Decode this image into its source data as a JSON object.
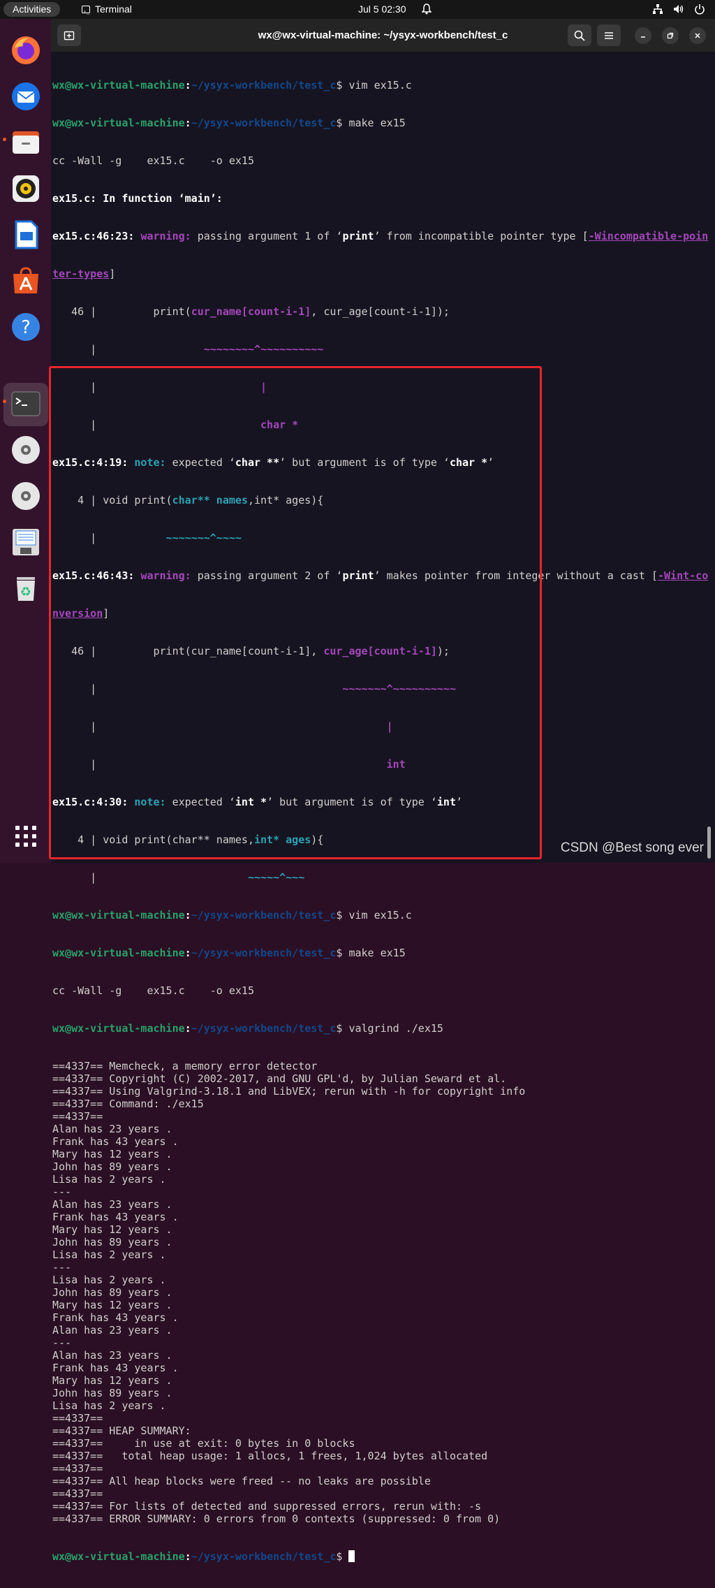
{
  "topbar": {
    "activities": "Activities",
    "app_name": "Terminal",
    "clock": "Jul 5  02:30",
    "tray_icons": [
      "network-icon",
      "volume-icon",
      "power-icon"
    ]
  },
  "dock": {
    "apps": [
      "firefox",
      "thunderbird",
      "files",
      "rhythmbox",
      "libreoffice-writer",
      "app-center",
      "help",
      "terminal",
      "disc-1",
      "disc-2",
      "floppy",
      "trash"
    ],
    "active": "terminal",
    "show_apps": "show-applications-icon"
  },
  "window": {
    "title": "wx@wx-virtual-machine: ~/ysyx-workbench/test_c"
  },
  "terminal": {
    "user": "wx@wx-virtual-machine",
    "path": "~/ysyx-workbench/test_c",
    "cmd_vim": "vim ex15.c",
    "cmd_make": "make ex15",
    "cmd_valgrind": "valgrind ./ex15",
    "cc_line": "cc -Wall -g    ex15.c    -o ex15",
    "in_function": "ex15.c: In function ‘main’:",
    "w1_loc": "ex15.c:46:23:",
    "w1_label": "warning:",
    "w1_text_a": "passing argument 1 of ‘",
    "w1_fn": "print",
    "w1_text_b": "’ from incompatible pointer type [",
    "w1_flag_a": "-Wincompatible-poin",
    "w1_flag_b": "ter-types",
    "w1_text_c": "]",
    "src46_num": "   46 |",
    "src46_a": "         print(",
    "src46_hl1": "cur_name[count-i-1]",
    "src46_b": ", cur_age[count-i-1]);",
    "carets1": "                 ~~~~~~~~^~~~~~~~~~~",
    "bar_char": "                          |",
    "type_char": "                          char *",
    "n1_loc": "ex15.c:4:19:",
    "n1_label": "note:",
    "n1_text_a": "expected ‘",
    "n1_type": "char **",
    "n1_text_b": "’ but argument is of type ‘",
    "n1_type2": "char *",
    "n1_text_c": "’",
    "src4_num": "    4 |",
    "src4_a": " void print(",
    "src4_hl": "char** names",
    "src4_b": ",int* ages){",
    "carets2": "           ~~~~~~~^~~~~",
    "w2_loc": "ex15.c:46:43:",
    "w2_label": "warning:",
    "w2_text_a": "passing argument 2 of ‘",
    "w2_fn": "print",
    "w2_text_b": "’ makes pointer from integer without a cast [",
    "w2_flag_a": "-Wint-co",
    "w2_flag_b": "nversion",
    "w2_text_c": "]",
    "src46b_a": "         print(cur_name[count-i-1], ",
    "src46b_hl": "cur_age[count-i-1]",
    "src46b_b": ");",
    "carets3": "                                       ~~~~~~~^~~~~~~~~~~",
    "bar_int": "                                              |",
    "type_int": "                                              int",
    "n2_loc": "ex15.c:4:30:",
    "n2_label": "note:",
    "n2_text_a": "expected ‘",
    "n2_type": "int *",
    "n2_text_b": "’ but argument is of type ‘",
    "n2_type2": "int",
    "n2_text_c": "’",
    "src4b_a": " void print(char** names,",
    "src4b_hl": "int* ages",
    "src4b_b": "){",
    "carets4": "                        ~~~~~^~~~",
    "gutter_blank": "      |",
    "vg_pid": "==4337==",
    "vg_lines": [
      "==4337== Memcheck, a memory error detector",
      "==4337== Copyright (C) 2002-2017, and GNU GPL'd, by Julian Seward et al.",
      "==4337== Using Valgrind-3.18.1 and LibVEX; rerun with -h for copyright info",
      "==4337== Command: ./ex15",
      "==4337==",
      "Alan has 23 years .",
      "Frank has 43 years .",
      "Mary has 12 years .",
      "John has 89 years .",
      "Lisa has 2 years .",
      "---",
      "Alan has 23 years .",
      "Frank has 43 years .",
      "Mary has 12 years .",
      "John has 89 years .",
      "Lisa has 2 years .",
      "---",
      "Lisa has 2 years .",
      "John has 89 years .",
      "Mary has 12 years .",
      "Frank has 43 years .",
      "Alan has 23 years .",
      "---",
      "Alan has 23 years .",
      "Frank has 43 years .",
      "Mary has 12 years .",
      "John has 89 years .",
      "Lisa has 2 years .",
      "==4337==",
      "==4337== HEAP SUMMARY:",
      "==4337==     in use at exit: 0 bytes in 0 blocks",
      "==4337==   total heap usage: 1 allocs, 1 frees, 1,024 bytes allocated",
      "==4337==",
      "==4337== All heap blocks were freed -- no leaks are possible",
      "==4337==",
      "==4337== For lists of detected and suppressed errors, rerun with: -s",
      "==4337== ERROR SUMMARY: 0 errors from 0 contexts (suppressed: 0 from 0)"
    ]
  },
  "watermark": "CSDN @Best song ever",
  "colors": {
    "prompt_user": "#26a269",
    "prompt_path": "#12488b",
    "warning": "#a347ba",
    "note": "#2aa1b3",
    "highlight_box": "#e8262a"
  }
}
